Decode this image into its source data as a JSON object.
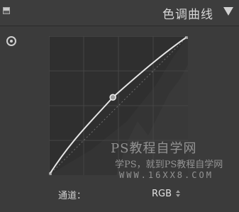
{
  "panel": {
    "title": "色调曲线",
    "collapse_icon": "collapse-square-icon",
    "menu_icon": "triangle-down-icon",
    "target_icon": "target-adjustment-icon"
  },
  "curve": {
    "control_points": [
      {
        "input": 0,
        "output": 0
      },
      {
        "input": 0.46,
        "output": 0.56
      },
      {
        "input": 1,
        "output": 1
      }
    ],
    "colors": {
      "background": "#3b3b3b",
      "graph_bg": "#2e2e2e",
      "curve": "#e6e6e6",
      "grid": "#454545"
    }
  },
  "watermark": {
    "line1": "PS教程自学网",
    "line2": "学PS，就到PS教程自学网",
    "line3": "WWW.16XX8.COM"
  },
  "footer": {
    "channel_label": "通道：",
    "channel_value": "RGB"
  }
}
